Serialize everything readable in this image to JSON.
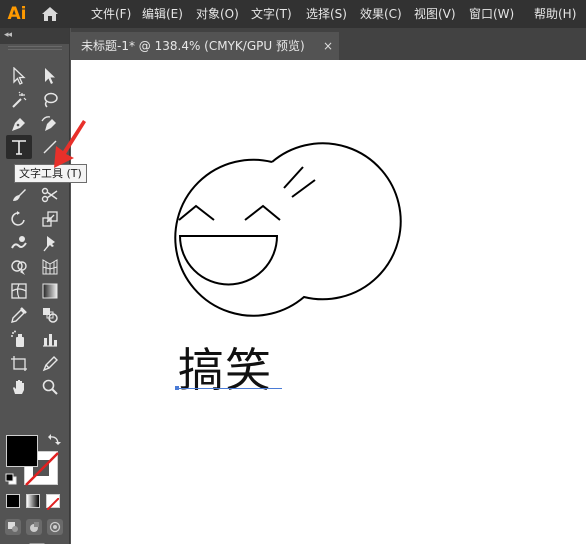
{
  "app": {
    "logo_text": "Ai",
    "accent_color": "#ff9a00"
  },
  "menu": {
    "items": [
      {
        "label": "文件(F)"
      },
      {
        "label": "编辑(E)"
      },
      {
        "label": "对象(O)"
      },
      {
        "label": "文字(T)"
      },
      {
        "label": "选择(S)"
      },
      {
        "label": "效果(C)"
      },
      {
        "label": "视图(V)"
      },
      {
        "label": "窗口(W)"
      },
      {
        "label": "帮助(H)"
      }
    ]
  },
  "toolbar": {
    "collapse_label": "◂◂",
    "tools": [
      {
        "name": "selection-tool-icon"
      },
      {
        "name": "direct-selection-tool-icon"
      },
      {
        "name": "magic-wand-tool-icon"
      },
      {
        "name": "lasso-tool-icon"
      },
      {
        "name": "pen-tool-icon"
      },
      {
        "name": "curvature-tool-icon"
      },
      {
        "name": "type-tool-icon",
        "active": true
      },
      {
        "name": "line-segment-tool-icon"
      },
      {
        "name": "paintbrush-tool-icon"
      },
      {
        "name": "scissors-tool-icon"
      },
      {
        "name": "rotate-tool-icon"
      },
      {
        "name": "scale-tool-icon"
      },
      {
        "name": "warp-tool-icon"
      },
      {
        "name": "puppet-warp-tool-icon"
      },
      {
        "name": "shape-builder-tool-icon"
      },
      {
        "name": "perspective-grid-tool-icon"
      },
      {
        "name": "mesh-tool-icon"
      },
      {
        "name": "gradient-tool-icon"
      },
      {
        "name": "eyedropper-tool-icon"
      },
      {
        "name": "blend-tool-icon"
      },
      {
        "name": "symbol-sprayer-tool-icon"
      },
      {
        "name": "column-graph-tool-icon"
      },
      {
        "name": "artboard-tool-icon"
      },
      {
        "name": "slice-tool-icon"
      },
      {
        "name": "hand-tool-icon"
      },
      {
        "name": "zoom-tool-icon"
      }
    ],
    "fill_color": "#000000",
    "stroke_color": "none"
  },
  "document": {
    "tab_label": "未标题-1* @ 138.4% (CMYK/GPU 预览)",
    "close_label": "×",
    "zoom": "138.4%",
    "artwork_text": "搞笑"
  },
  "tooltip": {
    "text": "文字工具 (T)"
  }
}
